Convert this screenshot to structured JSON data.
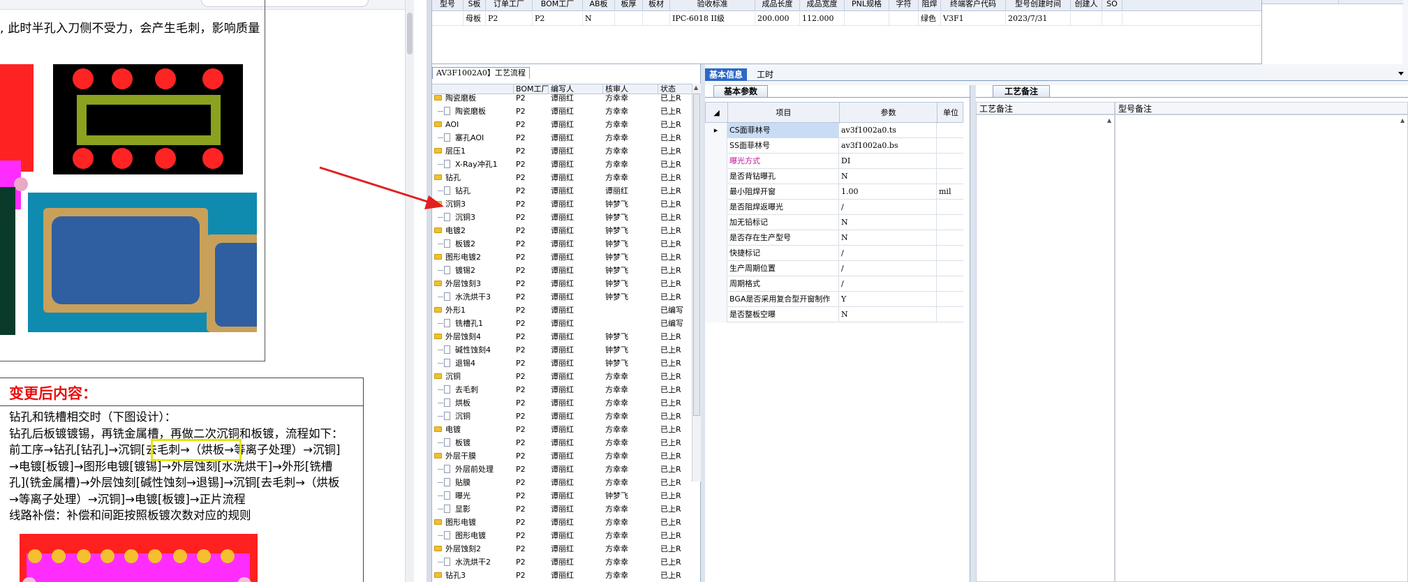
{
  "doc": {
    "text1": ", 此时半孔入刀侧不受力，会产生毛刺，影响质量",
    "after_title": "变更后内容：",
    "body": [
      "钻孔和铣槽相交时（下图设计）：",
      "钻孔后板镀镀锡，再铣金属槽，再做二次沉铜和板镀，流程如下：",
      "前工序→钻孔[钻孔]→沉铜[去毛刺→（烘板→等离子处理）→沉铜]",
      "→电镀[板镀]→图形电镀[镀锡]→外层蚀刻[水洗烘干]→外形[铣槽",
      "孔](铣金属槽)→外层蚀刻[碱性蚀刻→退锡]→沉铜[去毛刺→（烘板",
      "→等离子处理）→沉铜]→电镀[板镀]→正片流程",
      "线路补偿：补偿和间距按照板镀次数对应的规则"
    ]
  },
  "top_table": {
    "headers": [
      "型号",
      "S板",
      "订单工厂",
      "BOM工厂",
      "AB板",
      "板厚",
      "板材",
      "验收标准",
      "成品长度",
      "成品宽度",
      "PNL规格",
      "字符",
      "阻焊",
      "终端客户代码",
      "型号创建时间",
      "创建人",
      "SO"
    ],
    "row": [
      "",
      "母板",
      "P2",
      "P2",
      "N",
      "",
      "",
      "IPC-6018 II级",
      "200.000",
      "112.000",
      "",
      "",
      "绿色",
      "V3F1",
      "2023/7/31",
      "",
      ""
    ]
  },
  "tree": {
    "tab_label": "AV3F1002A0】工艺流程",
    "headers": [
      "",
      "BOM工厂",
      "编写人",
      "核审人",
      "状态"
    ],
    "rows": [
      {
        "name": "陶瓷磨板",
        "level": 0,
        "bom": "P2",
        "writer": "谭丽红",
        "reviewer": "方幸幸",
        "status": "已上R"
      },
      {
        "name": "陶瓷磨板",
        "level": 1,
        "bom": "P2",
        "writer": "谭丽红",
        "reviewer": "方幸幸",
        "status": "已上R"
      },
      {
        "name": "AOI",
        "level": 0,
        "bom": "P2",
        "writer": "谭丽红",
        "reviewer": "方幸幸",
        "status": "已上R"
      },
      {
        "name": "塞孔AOI",
        "level": 1,
        "bom": "P2",
        "writer": "谭丽红",
        "reviewer": "方幸幸",
        "status": "已上R"
      },
      {
        "name": "层压1",
        "level": 0,
        "bom": "P2",
        "writer": "谭丽红",
        "reviewer": "方幸幸",
        "status": "已上R"
      },
      {
        "name": "X-Ray冲孔1",
        "level": 1,
        "bom": "P2",
        "writer": "谭丽红",
        "reviewer": "方幸幸",
        "status": "已上R"
      },
      {
        "name": "钻孔",
        "level": 0,
        "bom": "P2",
        "writer": "谭丽红",
        "reviewer": "方幸幸",
        "status": "已上R"
      },
      {
        "name": "钻孔",
        "level": 1,
        "bom": "P2",
        "writer": "谭丽红",
        "reviewer": "谭丽红",
        "status": "已上R"
      },
      {
        "name": "沉铜3",
        "level": 0,
        "bom": "P2",
        "writer": "谭丽红",
        "reviewer": "钟梦飞",
        "status": "已上R"
      },
      {
        "name": "沉铜3",
        "level": 1,
        "bom": "P2",
        "writer": "谭丽红",
        "reviewer": "钟梦飞",
        "status": "已上R"
      },
      {
        "name": "电镀2",
        "level": 0,
        "bom": "P2",
        "writer": "谭丽红",
        "reviewer": "钟梦飞",
        "status": "已上R"
      },
      {
        "name": "板镀2",
        "level": 1,
        "bom": "P2",
        "writer": "谭丽红",
        "reviewer": "钟梦飞",
        "status": "已上R"
      },
      {
        "name": "图形电镀2",
        "level": 0,
        "bom": "P2",
        "writer": "谭丽红",
        "reviewer": "钟梦飞",
        "status": "已上R"
      },
      {
        "name": "镀锡2",
        "level": 1,
        "bom": "P2",
        "writer": "谭丽红",
        "reviewer": "钟梦飞",
        "status": "已上R"
      },
      {
        "name": "外层蚀刻3",
        "level": 0,
        "bom": "P2",
        "writer": "谭丽红",
        "reviewer": "钟梦飞",
        "status": "已上R"
      },
      {
        "name": "水洗烘干3",
        "level": 1,
        "bom": "P2",
        "writer": "谭丽红",
        "reviewer": "钟梦飞",
        "status": "已上R"
      },
      {
        "name": "外形1",
        "level": 0,
        "bom": "P2",
        "writer": "谭丽红",
        "reviewer": "",
        "status": "已编写"
      },
      {
        "name": "铣槽孔1",
        "level": 1,
        "bom": "P2",
        "writer": "谭丽红",
        "reviewer": "",
        "status": "已编写"
      },
      {
        "name": "外层蚀刻4",
        "level": 0,
        "bom": "P2",
        "writer": "谭丽红",
        "reviewer": "钟梦飞",
        "status": "已上R"
      },
      {
        "name": "碱性蚀刻4",
        "level": 1,
        "bom": "P2",
        "writer": "谭丽红",
        "reviewer": "钟梦飞",
        "status": "已上R"
      },
      {
        "name": "退锡4",
        "level": 1,
        "bom": "P2",
        "writer": "谭丽红",
        "reviewer": "钟梦飞",
        "status": "已上R"
      },
      {
        "name": "沉铜",
        "level": 0,
        "bom": "P2",
        "writer": "谭丽红",
        "reviewer": "方幸幸",
        "status": "已上R"
      },
      {
        "name": "去毛刺",
        "level": 1,
        "bom": "P2",
        "writer": "谭丽红",
        "reviewer": "方幸幸",
        "status": "已上R"
      },
      {
        "name": "烘板",
        "level": 1,
        "bom": "P2",
        "writer": "谭丽红",
        "reviewer": "方幸幸",
        "status": "已上R"
      },
      {
        "name": "沉铜",
        "level": 1,
        "bom": "P2",
        "writer": "谭丽红",
        "reviewer": "方幸幸",
        "status": "已上R"
      },
      {
        "name": "电镀",
        "level": 0,
        "bom": "P2",
        "writer": "谭丽红",
        "reviewer": "方幸幸",
        "status": "已上R"
      },
      {
        "name": "板镀",
        "level": 1,
        "bom": "P2",
        "writer": "谭丽红",
        "reviewer": "方幸幸",
        "status": "已上R"
      },
      {
        "name": "外层干膜",
        "level": 0,
        "bom": "P2",
        "writer": "谭丽红",
        "reviewer": "方幸幸",
        "status": "已上R"
      },
      {
        "name": "外层前处理",
        "level": 1,
        "bom": "P2",
        "writer": "谭丽红",
        "reviewer": "方幸幸",
        "status": "已上R"
      },
      {
        "name": "贴膜",
        "level": 1,
        "bom": "P2",
        "writer": "谭丽红",
        "reviewer": "方幸幸",
        "status": "已上R"
      },
      {
        "name": "曝光",
        "level": 1,
        "bom": "P2",
        "writer": "谭丽红",
        "reviewer": "钟梦飞",
        "status": "已上R"
      },
      {
        "name": "显影",
        "level": 1,
        "bom": "P2",
        "writer": "谭丽红",
        "reviewer": "方幸幸",
        "status": "已上R"
      },
      {
        "name": "图形电镀",
        "level": 0,
        "bom": "P2",
        "writer": "谭丽红",
        "reviewer": "方幸幸",
        "status": "已上R"
      },
      {
        "name": "图形电镀",
        "level": 1,
        "bom": "P2",
        "writer": "谭丽红",
        "reviewer": "方幸幸",
        "status": "已上R"
      },
      {
        "name": "外层蚀刻2",
        "level": 0,
        "bom": "P2",
        "writer": "谭丽红",
        "reviewer": "方幸幸",
        "status": "已上R"
      },
      {
        "name": "水洗烘干2",
        "level": 1,
        "bom": "P2",
        "writer": "谭丽红",
        "reviewer": "方幸幸",
        "status": "已上R"
      },
      {
        "name": "钻孔3",
        "level": 0,
        "bom": "P2",
        "writer": "谭丽红",
        "reviewer": "方幸幸",
        "status": "已上R"
      }
    ]
  },
  "detail": {
    "tabs": [
      "基本信息",
      "工时"
    ],
    "basic_params_tab": "基本参数",
    "grid_headers": [
      "项目",
      "参数",
      "单位"
    ],
    "grid_rows": [
      {
        "item": "CS面菲林号",
        "value": "av3f1002a0.ts",
        "unit": "",
        "selected": true,
        "pointer": true,
        "color": "#000000"
      },
      {
        "item": "SS面菲林号",
        "value": "av3f1002a0.bs",
        "unit": "",
        "selected": false,
        "pointer": false,
        "color": "#000000"
      },
      {
        "item": "曝光方式",
        "value": "DI",
        "unit": "",
        "selected": false,
        "pointer": false,
        "color": "#c0179c"
      },
      {
        "item": "是否背钻曝孔",
        "value": "N",
        "unit": "",
        "selected": false,
        "pointer": false,
        "color": "#000000"
      },
      {
        "item": "最小阻焊开窗",
        "value": "1.00",
        "unit": "mil",
        "selected": false,
        "pointer": false,
        "color": "#000000"
      },
      {
        "item": "是否阻焊返曝光",
        "value": "/",
        "unit": "",
        "selected": false,
        "pointer": false,
        "color": "#000000"
      },
      {
        "item": "加无铅标记",
        "value": "N",
        "unit": "",
        "selected": false,
        "pointer": false,
        "color": "#000000"
      },
      {
        "item": "是否存在生产型号",
        "value": "N",
        "unit": "",
        "selected": false,
        "pointer": false,
        "color": "#000000"
      },
      {
        "item": "快捷标记",
        "value": "/",
        "unit": "",
        "selected": false,
        "pointer": false,
        "color": "#000000"
      },
      {
        "item": "生产周期位置",
        "value": "/",
        "unit": "",
        "selected": false,
        "pointer": false,
        "color": "#000000"
      },
      {
        "item": "周期格式",
        "value": "/",
        "unit": "",
        "selected": false,
        "pointer": false,
        "color": "#000000"
      },
      {
        "item": "BGA是否采用复合型开窗制作",
        "value": "Y",
        "unit": "",
        "selected": false,
        "pointer": false,
        "color": "#000000"
      },
      {
        "item": "是否整板空曝",
        "value": "N",
        "unit": "",
        "selected": false,
        "pointer": false,
        "color": "#000000"
      }
    ],
    "proc_remarks_tab": "工艺备注",
    "remark_headers": [
      "工艺备注",
      "型号备注"
    ]
  },
  "colors": {
    "accent_tab": "#2d68c4",
    "title_red": "#e81010",
    "arrow_red": "#e02020",
    "highlight_yellow": "#e5e500"
  },
  "icons": {
    "tree_folder": "folder-icon",
    "tree_leaf": "document-icon",
    "row_pointer": "row-pointer-icon",
    "tab_dropdown": "dropdown-arrow-icon",
    "arrow": "red-arrow-annotation"
  }
}
